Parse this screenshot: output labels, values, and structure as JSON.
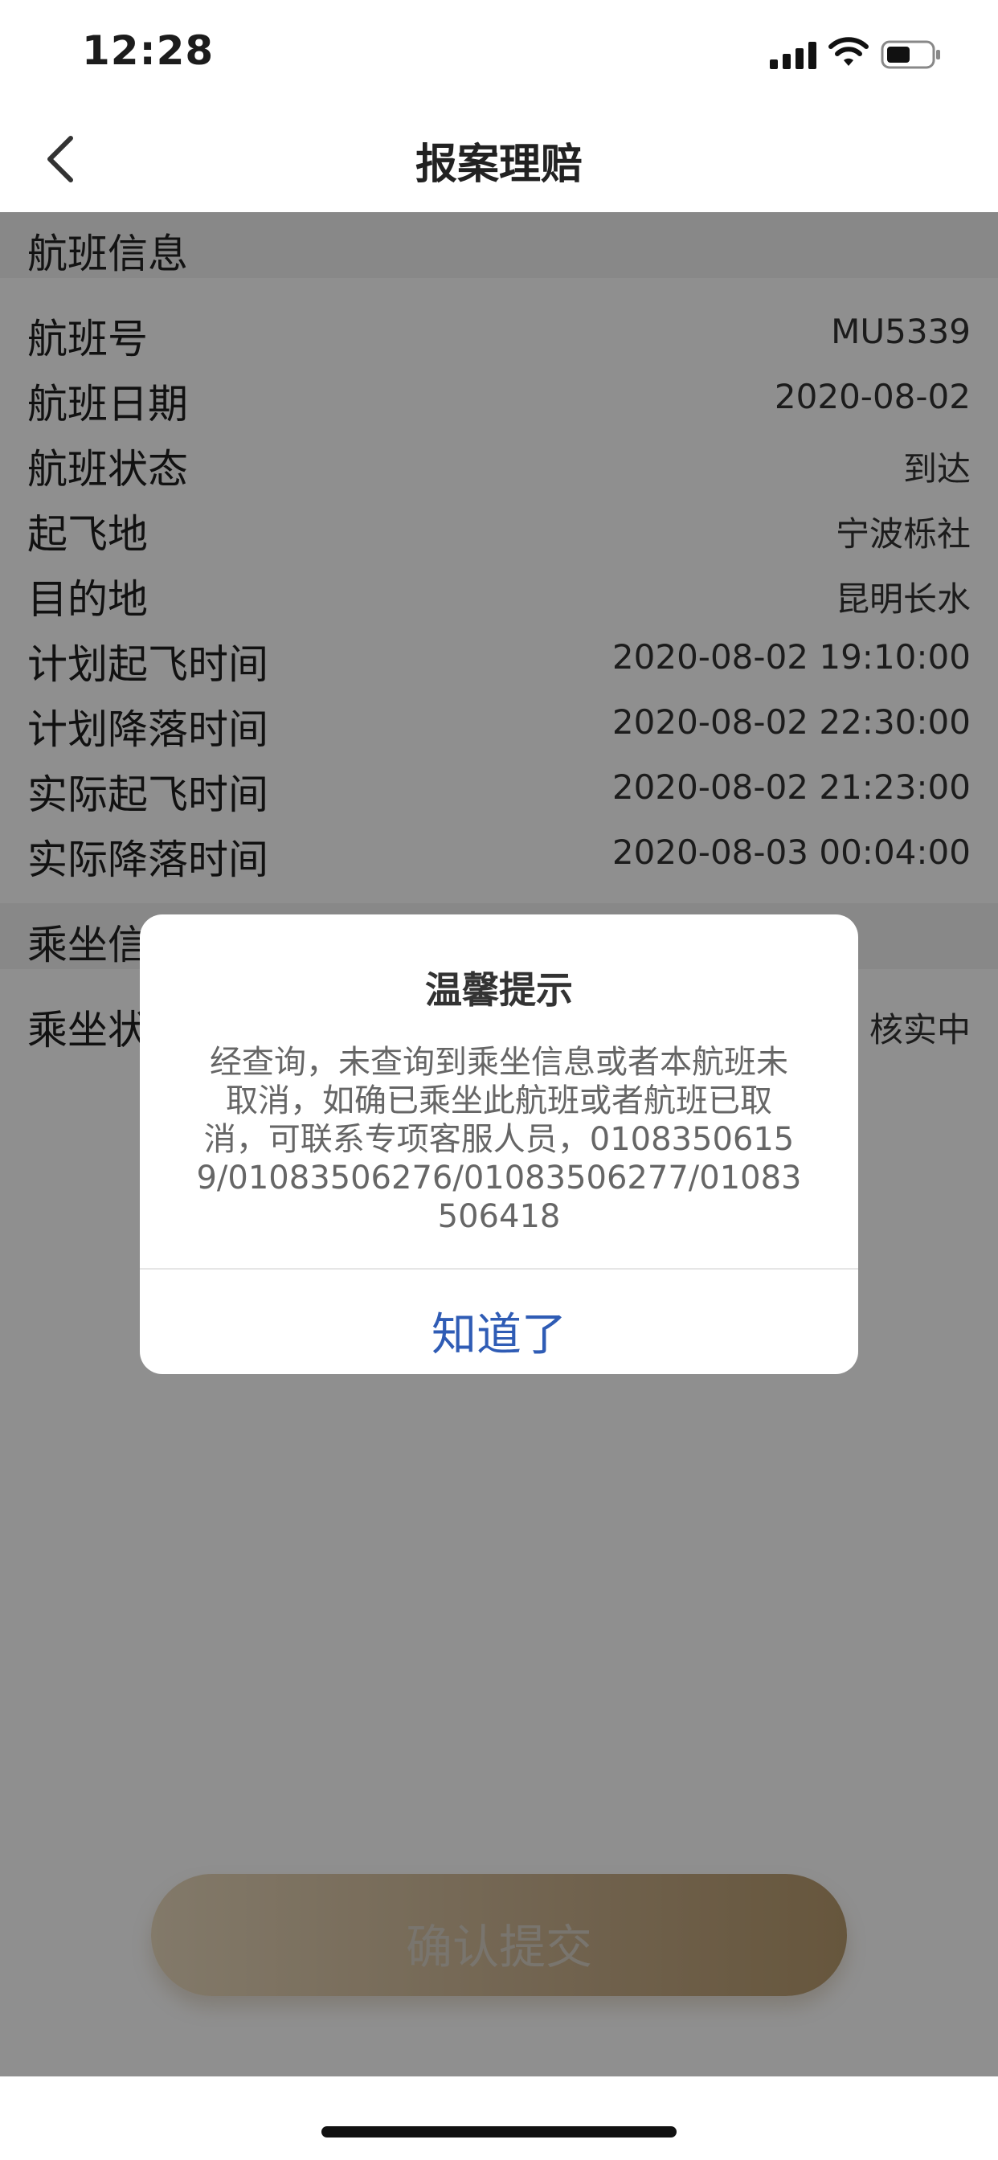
{
  "status_bar": {
    "time": "12:28"
  },
  "nav": {
    "title": "报案理赔"
  },
  "flight_section": {
    "title": "航班信息",
    "rows": [
      {
        "label": "航班号",
        "value": "MU5339"
      },
      {
        "label": "航班日期",
        "value": "2020-08-02"
      },
      {
        "label": "航班状态",
        "value": "到达"
      },
      {
        "label": "起飞地",
        "value": "宁波栎社"
      },
      {
        "label": "目的地",
        "value": "昆明长水"
      },
      {
        "label": "计划起飞时间",
        "value": "2020-08-02 19:10:00"
      },
      {
        "label": "计划降落时间",
        "value": "2020-08-02 22:30:00"
      },
      {
        "label": "实际起飞时间",
        "value": "2020-08-02 21:23:00"
      },
      {
        "label": "实际降落时间",
        "value": "2020-08-03 00:04:00"
      }
    ]
  },
  "ride_section": {
    "title": "乘坐信",
    "rows": [
      {
        "label": "乘坐状",
        "value": "核实中"
      }
    ]
  },
  "submit_button": {
    "label": "确认提交"
  },
  "dialog": {
    "title": "温馨提示",
    "message": "经查询，未查询到乘坐信息或者本航班未取消，如确已乘坐此航班或者航班已取消，可联系专项客服人员，01083506159/01083506276/01083506277/01083506418",
    "confirm_label": "知道了"
  },
  "colors": {
    "overlay": "rgba(0,0,0,0.44)",
    "dialog_button": "#2f5cb5",
    "submit_gradient_start": "#e9d9bd",
    "submit_gradient_end": "#b79a6d"
  }
}
